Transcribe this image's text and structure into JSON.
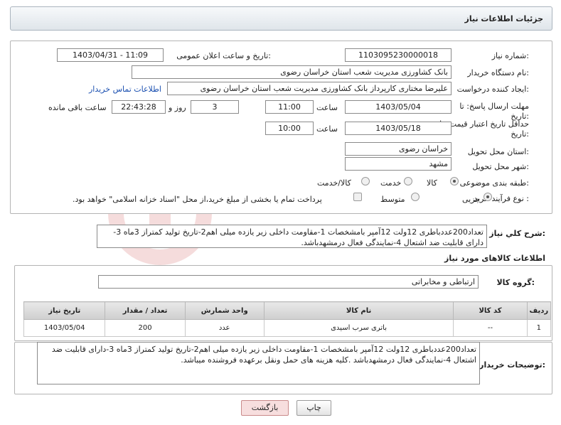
{
  "page": {
    "title": "جزئیات اطلاعات نیاز"
  },
  "form": {
    "need_number_label": "شماره نیاز:",
    "need_number": "1103095230000018",
    "announce_label": "تاریخ و ساعت اعلان عمومی:",
    "announce_value": "1403/04/31 - 11:09",
    "buyer_org_label": "نام دستگاه خریدار:",
    "buyer_org": "بانک کشاورزی مدیریت شعب استان خراسان رضوی",
    "creator_label": "ایجاد کننده درخواست:",
    "creator": "علیرضا مختاری کارپرداز بانک کشاورزی مدیریت شعب استان خراسان رضوی",
    "contact_link": "اطلاعات تماس خریدار",
    "reply_deadline_label": "مهلت ارسال پاسخ: تا تاریخ:",
    "reply_date": "1403/05/04",
    "time_label": "ساعت",
    "reply_time": "11:00",
    "days_value": "3",
    "days_label": "روز و",
    "remaining_time": "22:43:28",
    "remaining_label": "ساعت باقی مانده",
    "price_validity_label": "حداقل تاریخ اعتبار قیمت: تا تاریخ:",
    "validity_date": "1403/05/18",
    "validity_time_label": "ساعت",
    "validity_time": "10:00",
    "province_label": "استان محل تحویل:",
    "province": "خراسان رضوی",
    "city_label": "شهر محل تحویل:",
    "city": "مشهد",
    "category_label": "طبقه بندی موضوعی:",
    "category_options": [
      "کالا",
      "خدمت",
      "کالا/خدمت"
    ],
    "process_label": "نوع فرآیند خرید :",
    "process_options": [
      "جزیی",
      "متوسط"
    ],
    "payment_note": "پرداخت تمام یا بخشی از مبلغ خرید،از محل \"اسناد خزانه اسلامی\" خواهد بود."
  },
  "summary": {
    "label": "شرح کلي نياز:",
    "text": "تعداد200عددباطری 12ولت 12آمپر بامشخصات 1-مقاومت داخلی زیر یازده میلی اهم2-تاریخ تولید کمتراز 3ماه 3-دارای قابلیت ضد اشتعال 4-نمایندگی فعال درمشهدباشد."
  },
  "goods": {
    "section_title": "اطلاعات کالاهای مورد نیاز",
    "group_label": "گروه کالا:",
    "group_value": "ارتباطی و مخابراتی",
    "headers": [
      "ردیف",
      "کد کالا",
      "نام کالا",
      "واحد شمارش",
      "تعداد / مقدار",
      "تاریخ نیاز"
    ],
    "rows": [
      [
        "1",
        "--",
        "باتری سرب اسیدی",
        "عدد",
        "200",
        "1403/05/04"
      ]
    ]
  },
  "buyer_notes": {
    "label": "توضیحات خریدار:",
    "text": "تعداد200عددباطری 12ولت 12آمپر بامشخصات 1-مقاومت داخلی زیر یازده میلی اهم2-تاریخ تولید کمتراز 3ماه 3-دارای قابلیت ضد اشتعال 4-نمایندگی فعال درمشهدباشد .کلیه هزینه های حمل ونقل برعهده فروشنده میباشد."
  },
  "buttons": {
    "print": "چاپ",
    "back": "بازگشت"
  },
  "colors": {
    "link": "#1a4fb0",
    "back_bg": "#f7dede",
    "back_border": "#c98a8a"
  }
}
